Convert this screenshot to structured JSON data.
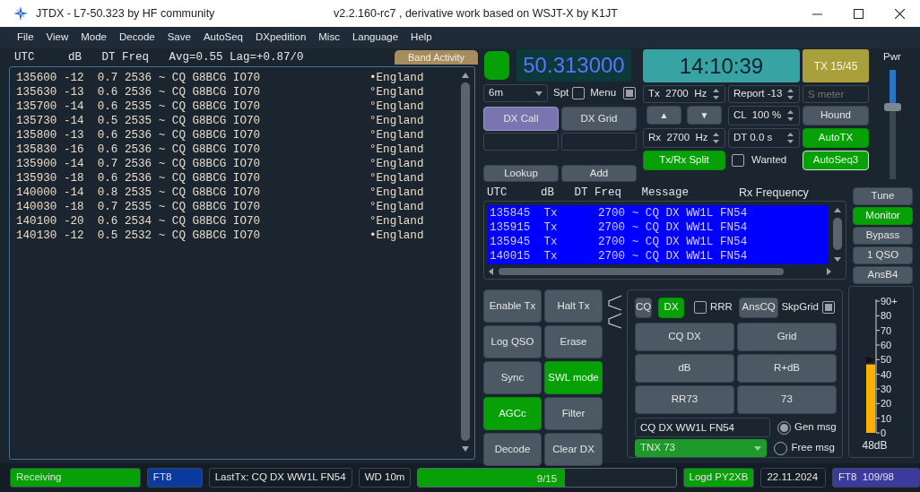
{
  "window": {
    "title": "JTDX - L7-50.323  by HF community",
    "subtitle": "v2.2.160-rc7 , derivative work based on WSJT-X by K1JT"
  },
  "menu": [
    "File",
    "View",
    "Mode",
    "Decode",
    "Save",
    "AutoSeq",
    "DXpedition",
    "Misc",
    "Language",
    "Help"
  ],
  "band_activity": {
    "header": "UTC     dB   DT Freq   Avg=0.55 Lag=+0.87/0",
    "button": "Band Activity",
    "rows": [
      {
        "text": "135600 -12  0.7 2536 ~ CQ G8BCG IO70",
        "country": "•England"
      },
      {
        "text": "135630 -13  0.6 2536 ~ CQ G8BCG IO70",
        "country": "°England"
      },
      {
        "text": "135700 -14  0.6 2535 ~ CQ G8BCG IO70",
        "country": "°England"
      },
      {
        "text": "135730 -14  0.5 2535 ~ CQ G8BCG IO70",
        "country": "°England"
      },
      {
        "text": "135800 -13  0.6 2536 ~ CQ G8BCG IO70",
        "country": "°England"
      },
      {
        "text": "135830 -16  0.6 2536 ~ CQ G8BCG IO70",
        "country": "°England"
      },
      {
        "text": "135900 -14  0.7 2536 ~ CQ G8BCG IO70",
        "country": "°England"
      },
      {
        "text": "135930 -18  0.6 2536 ~ CQ G8BCG IO70",
        "country": "°England"
      },
      {
        "text": "140000 -14  0.8 2535 ~ CQ G8BCG IO70",
        "country": "°England"
      },
      {
        "text": "140030 -18  0.7 2535 ~ CQ G8BCG IO70",
        "country": "°England"
      },
      {
        "text": "140100 -20  0.6 2534 ~ CQ G8BCG IO70",
        "country": "°England"
      },
      {
        "text": "140130 -12  0.5 2532 ~ CQ G8BCG IO70",
        "country": "•England"
      }
    ]
  },
  "controls": {
    "led": {
      "on": true
    },
    "frequency": "50.313000",
    "clock": "14:10:39",
    "tx_period": "TX 15/45",
    "band": "6m",
    "checks": [
      {
        "label": "Spt",
        "checked": false
      },
      {
        "label": "Menu",
        "checked": true
      }
    ],
    "dx_buttons": [
      {
        "label": "DX Call",
        "highlighted": true
      },
      {
        "label": "DX Grid",
        "highlighted": false
      }
    ],
    "lookup_buttons": [
      "Lookup",
      "Add"
    ],
    "tx_freq": "Tx  2700  Hz",
    "report": "Report -13",
    "s_meter": {
      "placeholder": "S meter"
    },
    "arrows": [
      "▲",
      "▼"
    ],
    "cl": "CL  100 %",
    "rx_freq": "Rx  2700  Hz",
    "dt": "DT 0.0 s",
    "side_buttons": [
      {
        "label": "Hound",
        "on": false
      },
      {
        "label": "AutoTX",
        "on": true
      },
      {
        "label": "AutoSeq3",
        "on": true
      }
    ],
    "split": {
      "label": "Tx/Rx Split",
      "on": true
    },
    "wanted": {
      "label": "Wanted",
      "checked": false
    },
    "power": {
      "label": "Pwr",
      "level": 0.67
    }
  },
  "rx_frequency": {
    "header": "UTC     dB   DT Freq   Message",
    "title": "Rx Frequency",
    "rows": [
      "135845  Tx      2700 ~ CQ DX WW1L FN54",
      "135915  Tx      2700 ~ CQ DX WW1L FN54",
      "135945  Tx      2700 ~ CQ DX WW1L FN54",
      "140015  Tx      2700 ~ CQ DX WW1L FN54"
    ]
  },
  "right_buttons": [
    {
      "label": "Tune",
      "on": false
    },
    {
      "label": "Monitor",
      "on": true
    },
    {
      "label": "Bypass",
      "on": false
    },
    {
      "label": "1 QSO",
      "on": false
    },
    {
      "label": "AnsB4",
      "on": false
    }
  ],
  "action_buttons": [
    {
      "label": "Enable Tx",
      "on": false
    },
    {
      "label": "Halt Tx",
      "on": false
    },
    {
      "label": "Log QSO",
      "on": false
    },
    {
      "label": "Erase",
      "on": false
    },
    {
      "label": "Sync",
      "on": false
    },
    {
      "label": "SWL mode",
      "on": true
    },
    {
      "label": "AGCc",
      "on": true
    },
    {
      "label": "Filter",
      "on": false
    },
    {
      "label": "Decode",
      "on": false
    },
    {
      "label": "Clear DX",
      "on": false
    }
  ],
  "messages": {
    "tabs": [
      {
        "label": "CQ",
        "selected": false
      },
      {
        "label": "DX",
        "selected": true
      }
    ],
    "rrr": {
      "label": "RRR",
      "checked": false
    },
    "ans_cq": "AnsCQ",
    "skip_grid": {
      "label": "SkpGrid",
      "checked": true
    },
    "buttons": [
      "CQ DX",
      "Grid",
      "dB",
      "R+dB",
      "RR73",
      "73"
    ],
    "gen_msg": "CQ DX WW1L FN54",
    "free_msg": "TNX 73",
    "modes": [
      {
        "label": "Gen msg",
        "selected": true
      },
      {
        "label": "Free msg",
        "selected": false
      }
    ]
  },
  "meter": {
    "level": 0.52,
    "ticks": [
      "90+",
      "80",
      "70",
      "60",
      "50",
      "40",
      "30",
      "20",
      "10",
      "0"
    ],
    "reading": "48dB"
  },
  "status_bar": {
    "state": "Receiving",
    "mode": "FT8",
    "last_tx": "LastTx: CQ DX WW1L FN54",
    "wd": "WD 10m",
    "period": {
      "text": "9/15",
      "level": 0.57
    },
    "logged": "Logd PY2XB",
    "date": "22.11.2024",
    "mode_counts": "FT8  109/98"
  }
}
